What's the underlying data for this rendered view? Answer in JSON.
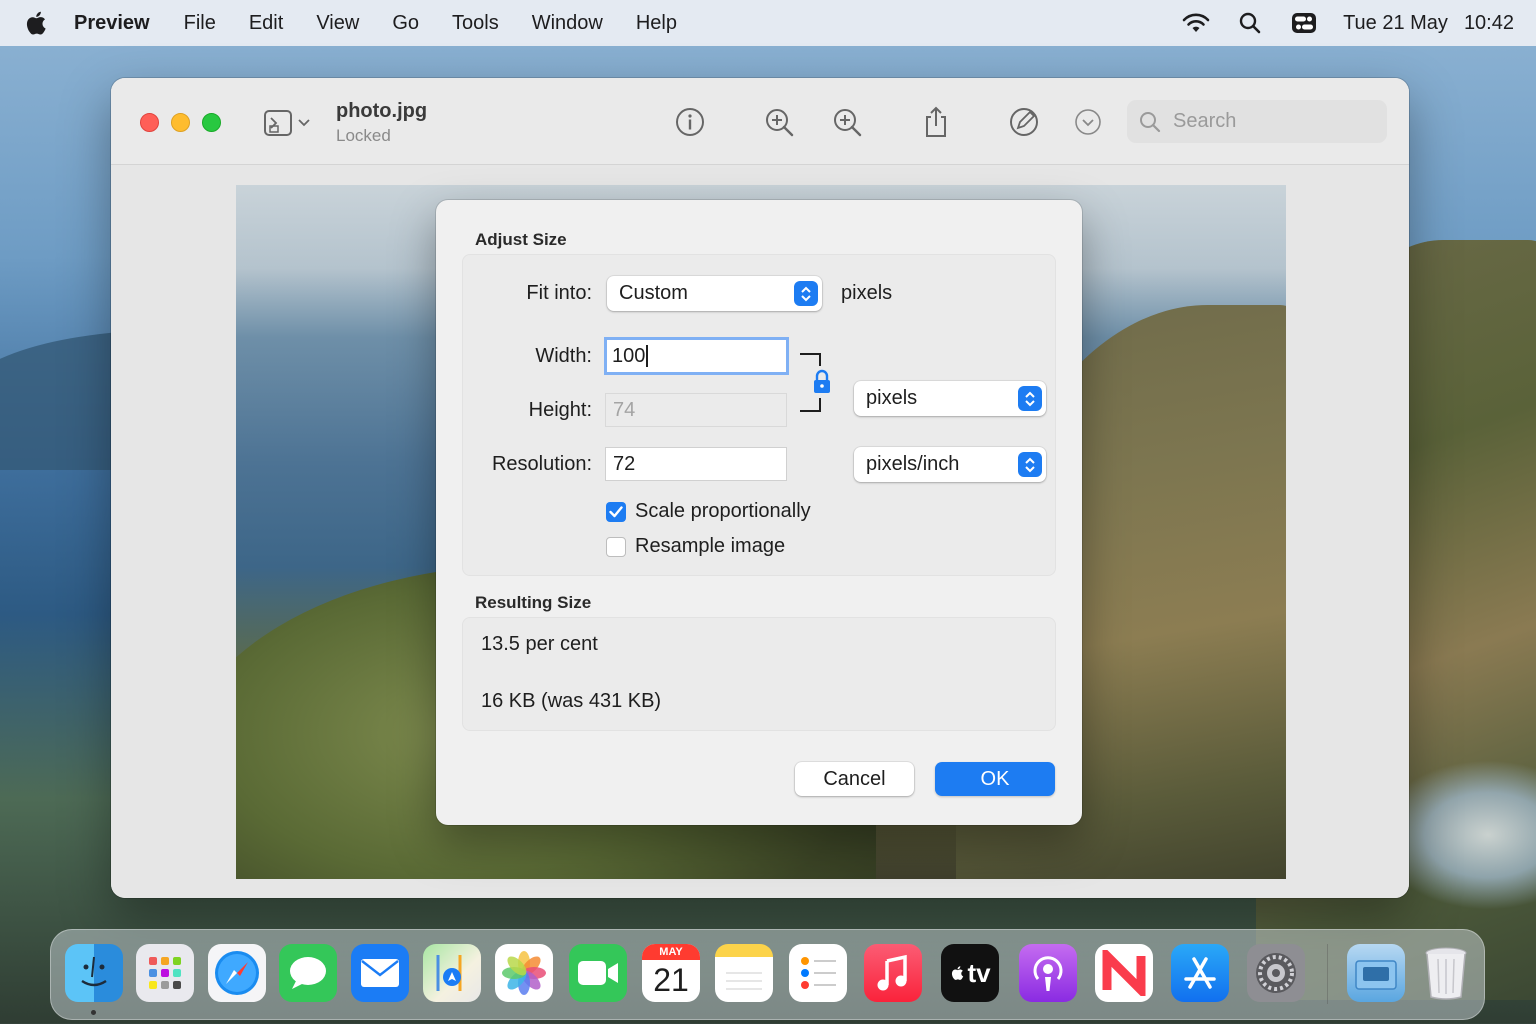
{
  "menubar": {
    "app_name": "Preview",
    "menus": [
      "File",
      "Edit",
      "View",
      "Go",
      "Tools",
      "Window",
      "Help"
    ],
    "date": "Tue 21 May",
    "time": "10:42",
    "status_icons": [
      "wifi-icon",
      "spotlight-search-icon",
      "control-center-icon"
    ]
  },
  "window": {
    "title": "photo.jpg",
    "subtitle": "Locked",
    "toolbar_icons": [
      "sidebar-icon",
      "info-icon",
      "zoom-out-icon",
      "zoom-in-icon",
      "share-icon",
      "markup-icon",
      "more-chevron-icon"
    ],
    "search_placeholder": "Search"
  },
  "dialog": {
    "section_adjust": "Adjust Size",
    "fit_into_label": "Fit into:",
    "fit_into_value": "Custom",
    "fit_into_unit": "pixels",
    "width_label": "Width:",
    "width_value": "100",
    "height_label": "Height:",
    "height_value": "74",
    "resolution_label": "Resolution:",
    "resolution_value": "72",
    "size_unit": "pixels",
    "resolution_unit": "pixels/inch",
    "scale_label": "Scale proportionally",
    "scale_checked": true,
    "resample_label": "Resample image",
    "resample_checked": false,
    "section_result": "Resulting Size",
    "result_percent": "13.5 per cent",
    "result_filesize": "16 KB (was 431 KB)",
    "cancel_label": "Cancel",
    "ok_label": "OK",
    "accent_color": "#1d7cf2"
  },
  "dock": {
    "calendar_month": "MAY",
    "calendar_day": "21",
    "tv_label": "tv",
    "apps": [
      "Finder",
      "Launchpad",
      "Safari",
      "Messages",
      "Mail",
      "Maps",
      "Photos",
      "FaceTime",
      "Calendar",
      "Notes",
      "Reminders",
      "Music",
      "TV",
      "Podcasts",
      "News",
      "App Store",
      "System Preferences",
      "Downloads",
      "Trash"
    ]
  }
}
